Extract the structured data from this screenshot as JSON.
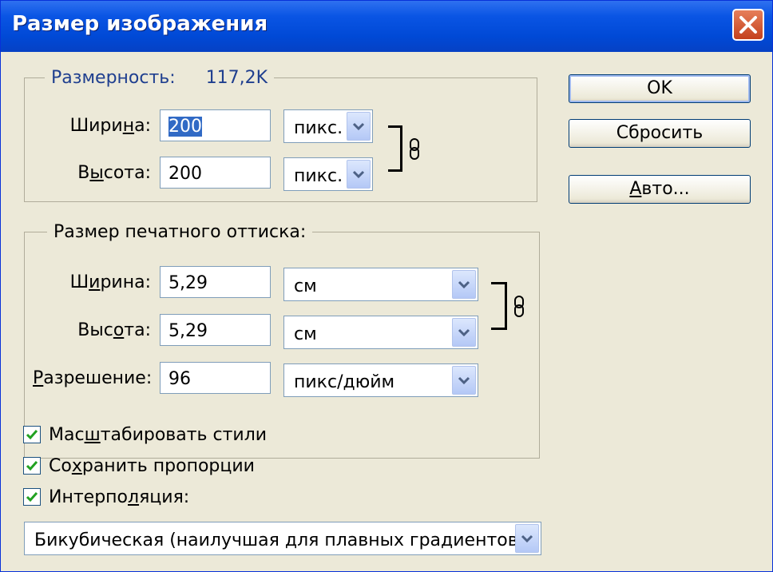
{
  "window": {
    "title": "Размер изображения"
  },
  "dimensions": {
    "legend_label": "Размерность:",
    "legend_value": "117,2K",
    "width": {
      "label_pre": "Шири",
      "label_u": "н",
      "label_post": "а:",
      "value": "200",
      "unit": "пикс."
    },
    "height": {
      "label_pre": "В",
      "label_u": "ы",
      "label_post": "сота:",
      "value": "200",
      "unit": "пикс."
    }
  },
  "print_size": {
    "legend": "Размер печатного оттиска:",
    "width": {
      "label_pre": "Ш",
      "label_u": "и",
      "label_post": "рина:",
      "value": "5,29",
      "unit": "см"
    },
    "height": {
      "label_pre": "Выс",
      "label_u": "о",
      "label_post": "та:",
      "value": "5,29",
      "unit": "см"
    },
    "resolution": {
      "label_pre": "",
      "label_u": "Р",
      "label_post": "азрешение:",
      "value": "96",
      "unit": "пикс/дюйм"
    }
  },
  "buttons": {
    "ok": "OK",
    "reset": "Сбросить",
    "auto_u": "А",
    "auto_rest": "вто..."
  },
  "checkboxes": {
    "scale_styles": {
      "pre": "Мас",
      "u": "ш",
      "post": "табировать стили",
      "checked": true
    },
    "constrain": {
      "pre": "Со",
      "u": "х",
      "post": "ранить пропорции",
      "checked": true
    },
    "resample": {
      "pre": "Интерпо",
      "u": "л",
      "post": "яция:",
      "checked": true
    }
  },
  "interpolation": {
    "value": "Бикубическая (наилучшая для плавных градиентов)"
  },
  "colors": {
    "title_bar": "#0a55e4",
    "close": "#c4401c",
    "legend_text": "#1f3f8f",
    "check": "#21a121"
  },
  "icons": [
    "close-icon",
    "chevron-down-icon",
    "chain-link-icon",
    "checkmark-icon"
  ]
}
